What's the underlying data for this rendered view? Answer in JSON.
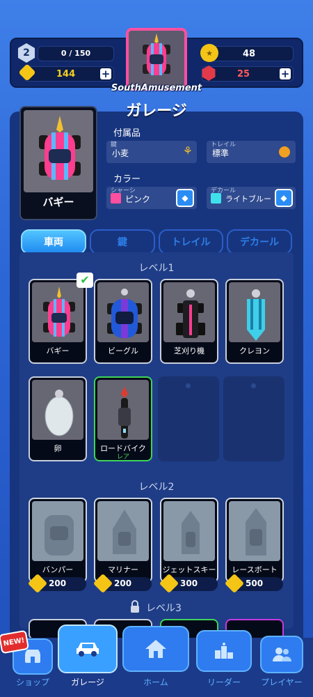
{
  "header": {
    "level": "2",
    "xp": "0 / 150",
    "currency_yellow": "144",
    "medals": "48",
    "gems": "25",
    "username": "SouthAmusement"
  },
  "title": "ガレージ",
  "preview": {
    "name": "バギー"
  },
  "accessories": {
    "heading": "付属品",
    "key_label": "鍵",
    "key_value": "小麦",
    "trail_label": "トレイル",
    "trail_value": "標準"
  },
  "color": {
    "heading": "カラー",
    "chassis_label": "シャーシ",
    "chassis_value": "ピンク",
    "decal_label": "デカール",
    "decal_value": "ライトブルー"
  },
  "tabs": [
    "車両",
    "鍵",
    "トレイル",
    "デカール"
  ],
  "level1": {
    "header": "レベル1",
    "items": [
      {
        "name": "バギー"
      },
      {
        "name": "ビーグル"
      },
      {
        "name": "芝刈り機"
      },
      {
        "name": "クレヨン"
      },
      {
        "name": "卵"
      },
      {
        "name": "ロードバイク",
        "rarity": "レア"
      }
    ]
  },
  "level2": {
    "header": "レベル2",
    "items": [
      {
        "name": "バンパー",
        "price": "200"
      },
      {
        "name": "マリナー",
        "price": "200"
      },
      {
        "name": "ジェットスキー",
        "price": "300"
      },
      {
        "name": "レースボート",
        "price": "500"
      }
    ]
  },
  "level3": {
    "header": "レベル3"
  },
  "nav": {
    "new_badge": "NEW!",
    "shop": "ショップ",
    "garage": "ガレージ",
    "home": "ホーム",
    "leader": "リーダー",
    "player": "プレイヤー"
  },
  "colors": {
    "pink": "#ff4fa0",
    "light_blue": "#3fe0ea",
    "accent": "#2e7cf0"
  }
}
